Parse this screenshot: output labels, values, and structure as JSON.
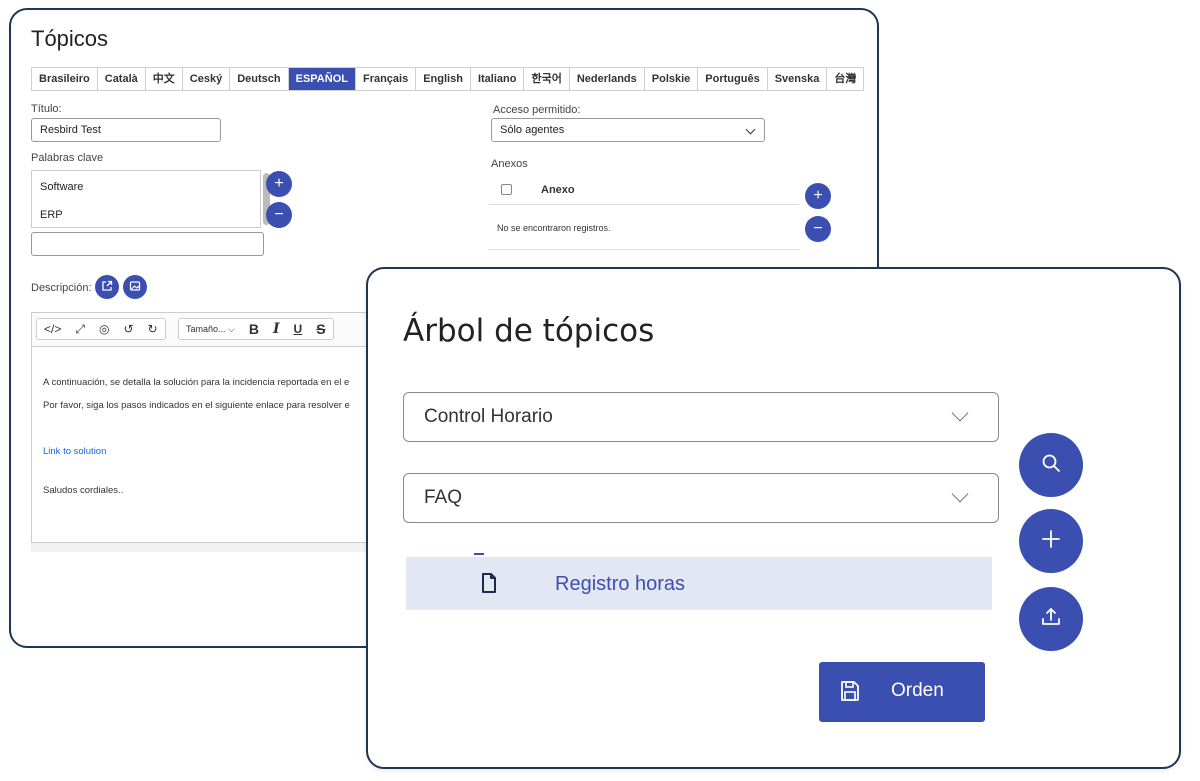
{
  "topics_form": {
    "title": "Tópicos",
    "tabs": [
      "Brasileiro",
      "Català",
      "中文",
      "Ceský",
      "Deutsch",
      "ESPAÑOL",
      "Français",
      "English",
      "Italiano",
      "한국어",
      "Nederlands",
      "Polskie",
      "Português",
      "Svenska",
      "台灣"
    ],
    "active_tab": "ESPAÑOL",
    "titulo_label": "Título:",
    "titulo_value": "Resbird Test",
    "keywords_label": "Palabras clave",
    "keywords": [
      "Software",
      "ERP"
    ],
    "acceso_label": "Acceso permitido:",
    "acceso_value": "Sólo agentes",
    "anexos_label": "Anexos",
    "anexo_column": "Anexo",
    "no_records": "No se encontraron registros.",
    "descripcion_label": "Descripción:",
    "toolbar_size": "Tamaño...",
    "editor_lines": {
      "line1": "A continuación, se detalla la solución para la incidencia reportada en el e",
      "line2": "Por favor, siga los pasos indicados en el siguiente enlace para resolver e",
      "link": "Link to solution",
      "closing": "Saludos cordiales.."
    }
  },
  "topic_tree": {
    "title": "Árbol de tópicos",
    "select1": "Control Horario",
    "select2": "FAQ",
    "tree_item": "Registro horas",
    "order_button": "Orden"
  },
  "colors": {
    "accent": "#3b4fb0",
    "border": "#1e3553",
    "highlight": "#e3e6f3"
  }
}
